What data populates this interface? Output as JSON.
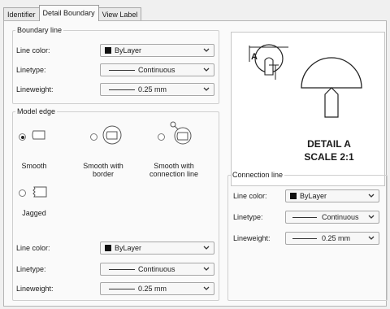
{
  "tabs": [
    {
      "label": "Identifier"
    },
    {
      "label": "Detail Boundary"
    },
    {
      "label": "View Label"
    }
  ],
  "boundary_line": {
    "title": "Boundary line",
    "line_color_label": "Line color:",
    "line_color_value": "ByLayer",
    "linetype_label": "Linetype:",
    "linetype_value": "Continuous",
    "lineweight_label": "Lineweight:",
    "lineweight_value": "0.25 mm"
  },
  "model_edge": {
    "title": "Model edge",
    "options": [
      {
        "label": "Smooth",
        "checked": true
      },
      {
        "label": "Smooth with border",
        "checked": false
      },
      {
        "label": "Smooth with connection line",
        "checked": false
      },
      {
        "label": "Jagged",
        "checked": false
      }
    ],
    "line_color_label": "Line color:",
    "line_color_value": "ByLayer",
    "linetype_label": "Linetype:",
    "linetype_value": "Continuous",
    "lineweight_label": "Lineweight:",
    "lineweight_value": "0.25 mm"
  },
  "preview": {
    "callout_letter": "A",
    "detail_title": "DETAIL A",
    "detail_scale": "SCALE 2:1"
  },
  "connection_line": {
    "title": "Connection line",
    "line_color_label": "Line color:",
    "line_color_value": "ByLayer",
    "linetype_label": "Linetype:",
    "linetype_value": "Continuous",
    "lineweight_label": "Lineweight:",
    "lineweight_value": "0.25 mm"
  },
  "colors": {
    "swatch": "#111111",
    "border": "#a7a7a7",
    "panel_bg": "#fafafa"
  }
}
